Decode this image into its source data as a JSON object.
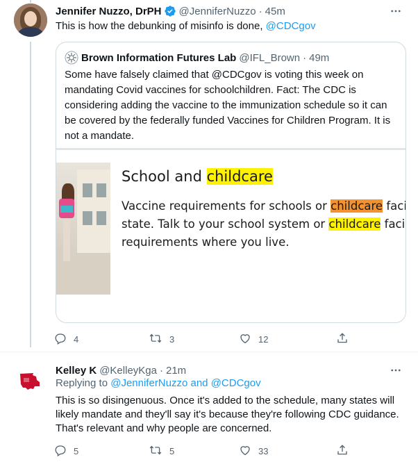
{
  "colors": {
    "accent": "#1d9bf0",
    "muted": "#536471",
    "highlight_yellow": "#fff200",
    "highlight_orange": "#f39230"
  },
  "tweet1": {
    "author_name": "Jennifer Nuzzo, DrPH",
    "handle": "@JenniferNuzzo",
    "time": "45m",
    "text_prefix": "This is how the debunking of misinfo is done, ",
    "text_mention": "@CDCgov",
    "quote": {
      "author_name": "Brown Information Futures Lab",
      "handle": "@IFL_Brown",
      "time": "49m",
      "text": "Some have falsely claimed that @CDCgov is voting this week on mandating Covid vaccines for schoolchildren. Fact: The CDC is considering adding the vaccine to the immunization schedule so it can be covered by the federally funded Vaccines for Children Program. It is not a mandate.",
      "image": {
        "title_prefix": "School and ",
        "title_highlight": "childcare",
        "line1_prefix": "Vaccine requirements for schools or ",
        "line1_highlight": "childcare",
        "line1_suffix": " facil",
        "line2_prefix": "state. Talk to your school system or ",
        "line2_highlight": "childcare",
        "line2_suffix": " faciliti",
        "line3": "requirements where you live."
      }
    },
    "actions": {
      "replies": "4",
      "retweets": "3",
      "likes": "12"
    }
  },
  "tweet2": {
    "author_name": "Kelley K",
    "handle": "@KelleyKga",
    "time": "21m",
    "replying_label": "Replying to ",
    "replying_user1": "@JenniferNuzzo",
    "replying_and": " and ",
    "replying_user2": "@CDCgov",
    "text": "This is so disingenuous. Once it's added to the schedule, many states will likely mandate and they'll say it's because they're following CDC guidance. That's relevant and why people are concerned.",
    "actions": {
      "replies": "5",
      "retweets": "5",
      "likes": "33"
    }
  },
  "icons": [
    "more-icon",
    "verified-icon",
    "reply-icon",
    "retweet-icon",
    "like-icon",
    "share-icon"
  ]
}
